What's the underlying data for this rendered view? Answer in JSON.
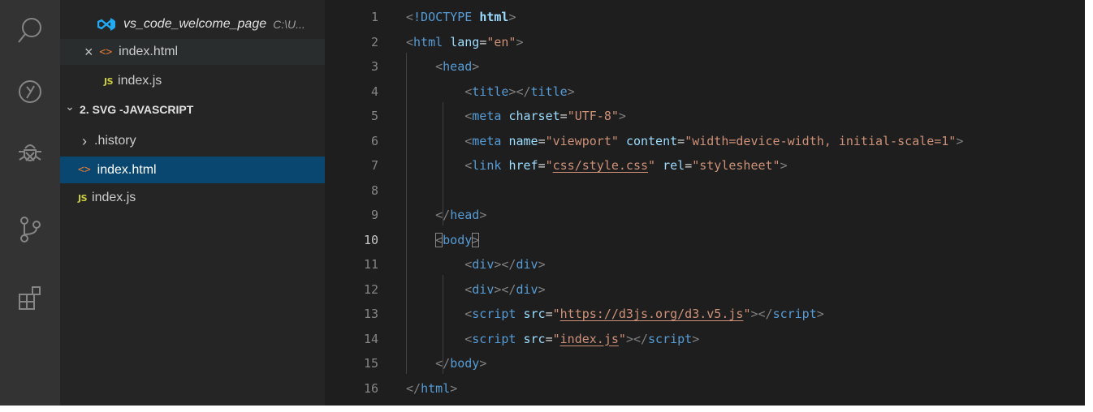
{
  "activity_bar": {
    "icons": [
      "search-icon",
      "run-debug-icon",
      "bug-icon",
      "source-control-icon",
      "extensions-icon"
    ]
  },
  "explorer": {
    "open_editors": [
      {
        "name": "vs_code_welcome_page",
        "path": "C:\\U...",
        "icon": "vscode-icon"
      },
      {
        "name": "index.html",
        "icon": "html-icon",
        "close": "×"
      },
      {
        "name": "index.js",
        "icon": "js-icon"
      }
    ],
    "folder": {
      "name": "2. SVG -JAVASCRIPT",
      "items": [
        {
          "name": ".history",
          "type": "folder"
        },
        {
          "name": "index.html",
          "type": "html",
          "active": true
        },
        {
          "name": "index.js",
          "type": "js"
        }
      ]
    },
    "html_badge": "<>",
    "js_badge": "JS",
    "chevron_right": "›",
    "chevron_down": "⌄"
  },
  "editor": {
    "current_line": 10,
    "lines": [
      {
        "n": "1"
      },
      {
        "n": "2"
      },
      {
        "n": "3"
      },
      {
        "n": "4"
      },
      {
        "n": "5"
      },
      {
        "n": "6"
      },
      {
        "n": "7"
      },
      {
        "n": "8"
      },
      {
        "n": "9"
      },
      {
        "n": "10"
      },
      {
        "n": "11"
      },
      {
        "n": "12"
      },
      {
        "n": "13"
      },
      {
        "n": "14"
      },
      {
        "n": "15"
      },
      {
        "n": "16"
      }
    ]
  },
  "colors": {
    "activity_bar": "#333333",
    "sidebar": "#252526",
    "editor_bg": "#1e1e1e",
    "selection": "#094771",
    "tag": "#569cd6",
    "attribute": "#9cdcfe",
    "string": "#ce9178"
  }
}
